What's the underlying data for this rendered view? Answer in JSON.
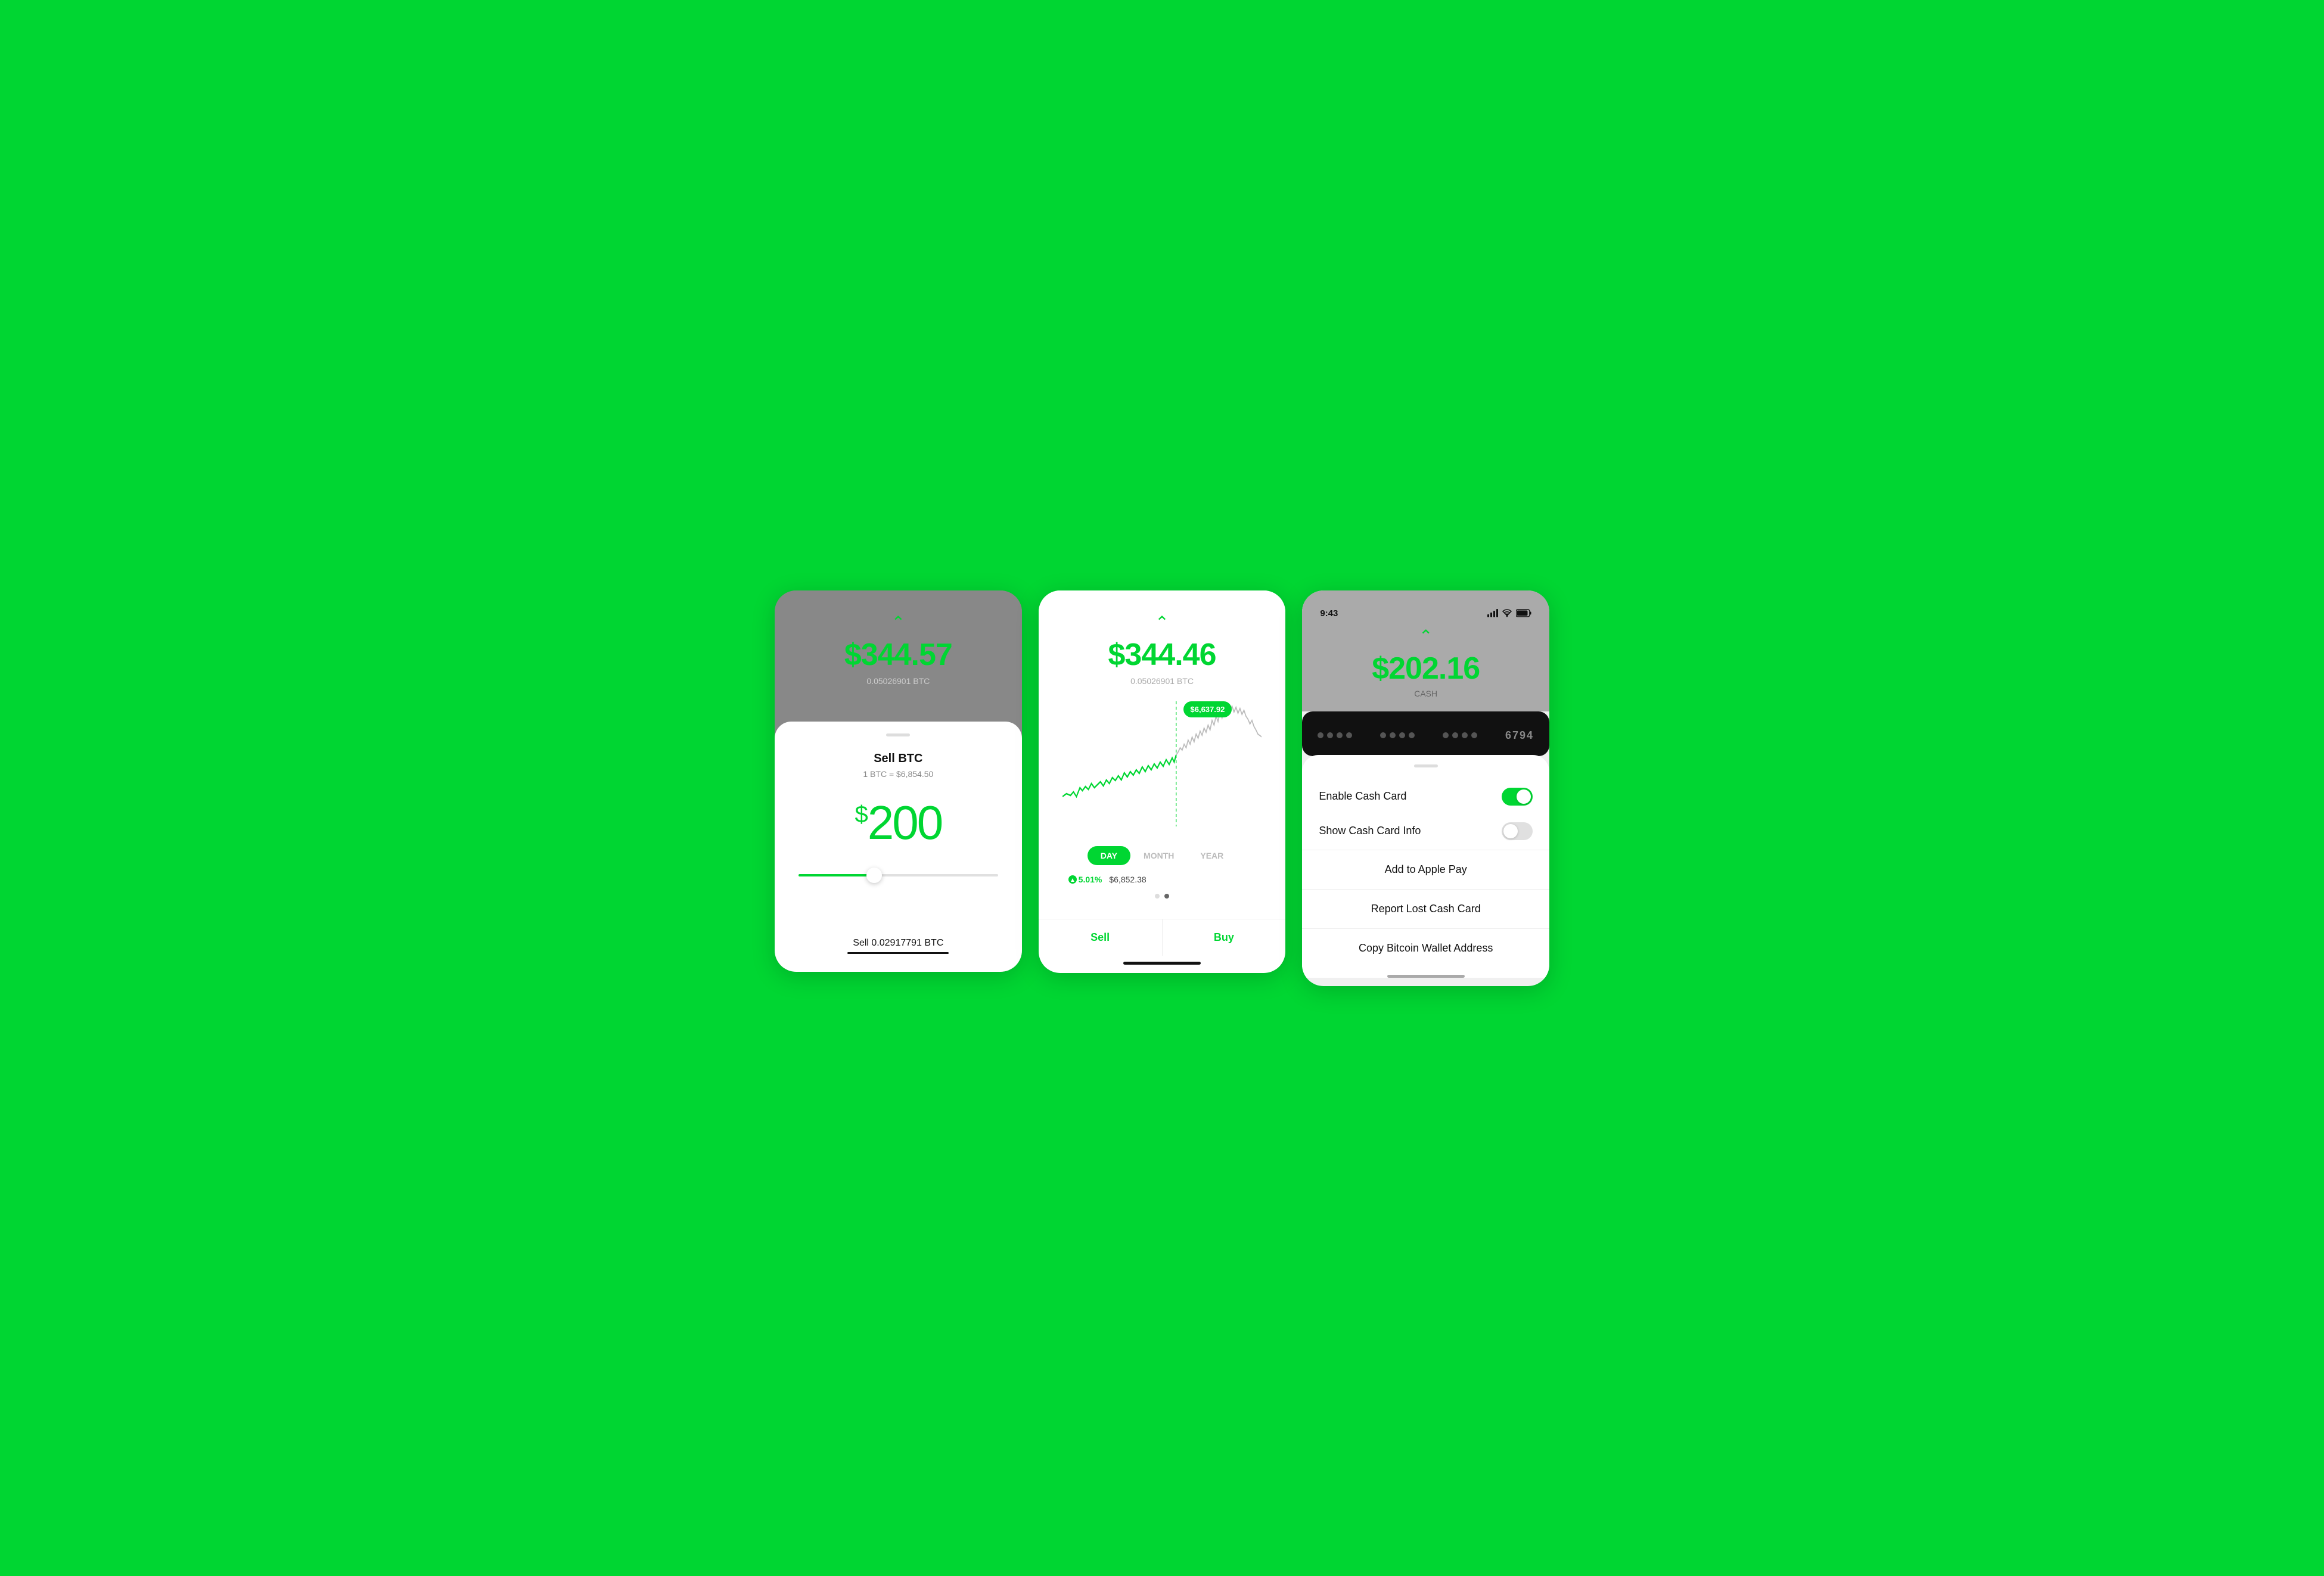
{
  "background_color": "#00d632",
  "screens": {
    "screen1": {
      "top": {
        "chevron": "^",
        "price": "$344.57",
        "btc_amount": "0.05026901 BTC"
      },
      "bottom": {
        "title": "Sell BTC",
        "rate": "1 BTC = $6,854.50",
        "amount_symbol": "$",
        "amount": "200",
        "sell_label": "Sell 0.02917791 BTC"
      }
    },
    "screen2": {
      "top": {
        "chevron": "^",
        "price": "$344.46",
        "btc_amount": "0.05026901 BTC"
      },
      "chart": {
        "tooltip": "$6,637.92"
      },
      "time_tabs": [
        "DAY",
        "MONTH",
        "YEAR"
      ],
      "active_tab": "DAY",
      "stats": {
        "percent": "5.01%",
        "price": "$6,852.38"
      },
      "actions": {
        "sell": "Sell",
        "buy": "Buy"
      }
    },
    "screen3": {
      "status_bar": {
        "time": "9:43",
        "location_icon": "arrow-icon"
      },
      "top": {
        "chevron": "^",
        "amount": "$202.16",
        "label": "CASH"
      },
      "card": {
        "number_end": "6794"
      },
      "sheet": {
        "items": [
          {
            "label": "Enable Cash Card",
            "type": "toggle",
            "state": "on"
          },
          {
            "label": "Show Cash Card Info",
            "type": "toggle",
            "state": "off"
          },
          {
            "label": "Add to Apple Pay",
            "type": "action"
          },
          {
            "label": "Report Lost Cash Card",
            "type": "action"
          },
          {
            "label": "Copy Bitcoin Wallet Address",
            "type": "action"
          }
        ]
      }
    }
  }
}
